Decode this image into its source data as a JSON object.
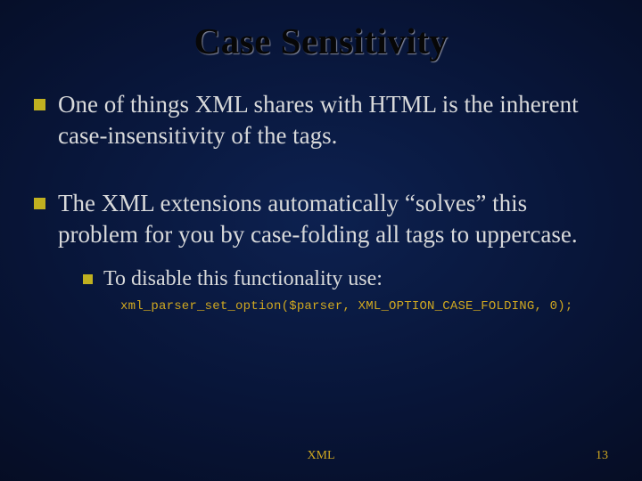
{
  "title": "Case Sensitivity",
  "bullets": [
    {
      "text": "One of things XML shares with HTML is the inherent case-insensitivity of the tags."
    },
    {
      "text": "The XML extensions automatically “solves” this problem for you by case-folding all tags to uppercase.",
      "sub": {
        "text": "To disable this functionality use:",
        "code": "xml_parser_set_option($parser, XML_OPTION_CASE_FOLDING, 0);"
      }
    }
  ],
  "footer": {
    "label": "XML",
    "page": "13"
  }
}
